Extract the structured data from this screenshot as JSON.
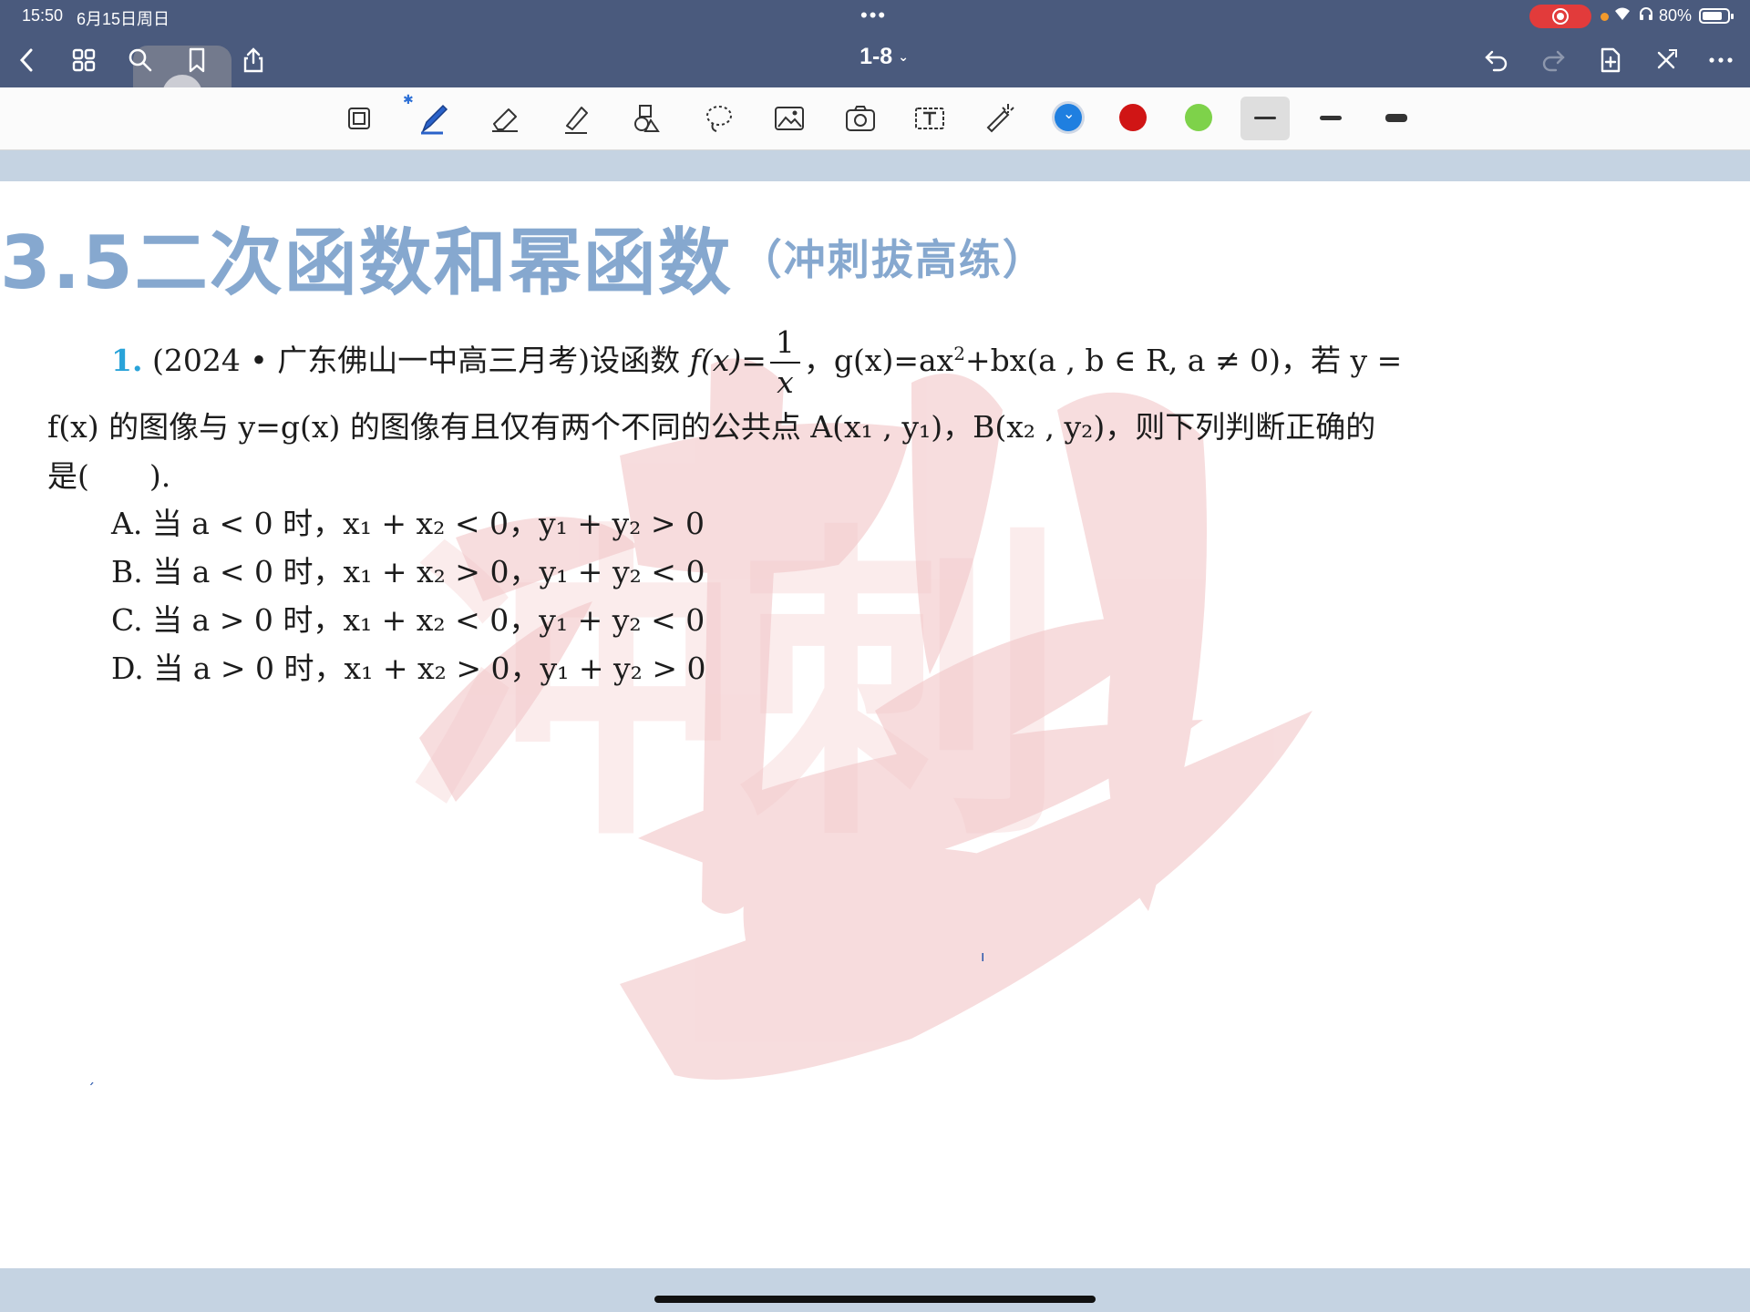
{
  "status": {
    "time": "15:50",
    "date": "6月15日周日",
    "battery_text": "80%",
    "battery_level": 0.8
  },
  "nav": {
    "title": "1-8",
    "icons": [
      "back-chevron-icon",
      "grid-icon",
      "search-icon",
      "bookmark-icon",
      "share-icon",
      "undo-icon",
      "redo-icon",
      "add-page-icon",
      "close-icon",
      "more-icon"
    ]
  },
  "toolbar": {
    "tools": [
      "read-mode-icon",
      "pen-icon",
      "eraser-icon",
      "highlighter-icon",
      "shapes-icon",
      "lasso-icon",
      "image-icon",
      "camera-icon",
      "text-box-icon",
      "laser-pointer-icon"
    ],
    "colors": {
      "selected": "#1f7fe0",
      "red": "#d01515",
      "green": "#7ed24a"
    },
    "strokes": [
      "thin",
      "medium",
      "thick"
    ]
  },
  "document": {
    "title_main": "3.5二次函数和幂函数",
    "title_sub": "（冲刺拔高练）",
    "question": {
      "number": "1.",
      "line1_a": "(2024 • 广东佛山一中高三月考)设函数",
      "f_def": "f(x)=",
      "frac_num": "1",
      "frac_den": "x",
      "line1_b": "，g(x)=ax",
      "sup2": "2",
      "line1_c": "+bx(a , b ∈ R, a ≠ 0)，若 y =",
      "line2": "f(x) 的图像与 y=g(x) 的图像有且仅有两个不同的公共点 A(x₁ , y₁)，B(x₂ , y₂)，则下列判断正确的",
      "line3": "是(　　)."
    },
    "options": [
      "A.  当 a < 0 时，x₁ + x₂ < 0，y₁ + y₂ > 0",
      "B.  当 a < 0 时，x₁ + x₂ > 0，y₁ + y₂ < 0",
      "C.  当 a > 0 时，x₁ + x₂ < 0，y₁ + y₂ < 0",
      "D.  当 a > 0 时，x₁ + x₂ > 0，y₁ + y₂ > 0"
    ],
    "watermark_text": "冲刺"
  }
}
